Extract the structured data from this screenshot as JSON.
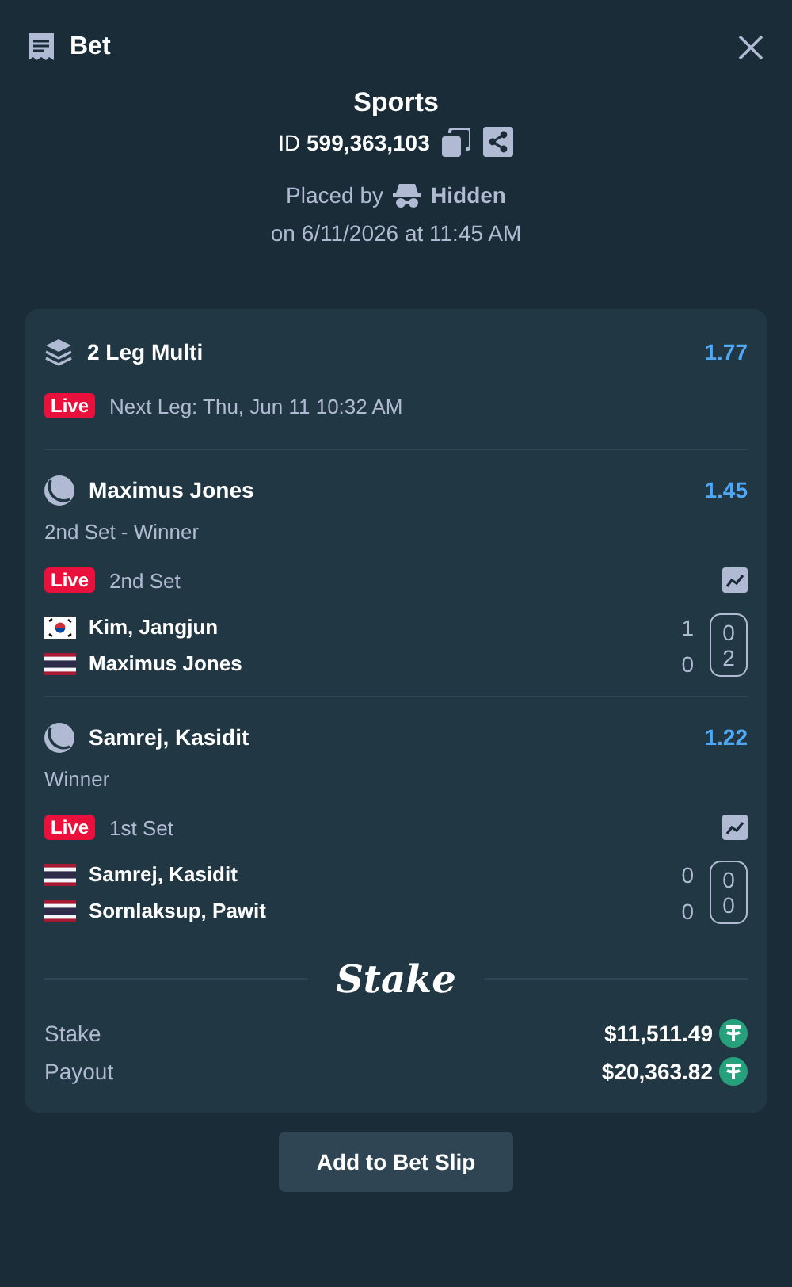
{
  "header": {
    "title": "Bet"
  },
  "summary": {
    "category": "Sports",
    "bet_id": "ID **599,363,103**",
    "placed_by_label": "Placed by",
    "user": "Hidden",
    "placed_on": "on 6/11/2026 at 11:45 AM"
  },
  "multi": {
    "title": "2 Leg Multi",
    "odds": "1.77",
    "live_badge": "Live",
    "next_leg": "Next Leg: Thu, Jun 11 10:32 AM"
  },
  "legs": [
    {
      "selection": "Maximus Jones",
      "odds": "1.45",
      "market": "2nd Set - Winner",
      "live_badge": "Live",
      "period": "2nd Set",
      "players": [
        {
          "name": "Kim, Jangjun",
          "kind": "kr",
          "score": "1",
          "current_score": "0"
        },
        {
          "name": "Maximus Jones",
          "kind": "th",
          "score": "0",
          "current_score": "2"
        }
      ]
    },
    {
      "selection": "Samrej, Kasidit",
      "odds": "1.22",
      "market": "Winner",
      "live_badge": "Live",
      "period": "1st Set",
      "players": [
        {
          "name": "Samrej, Kasidit",
          "kind": "th",
          "score": "0",
          "current_score": "0"
        },
        {
          "name": "Sornlaksup, Pawit",
          "kind": "th",
          "score": "0",
          "current_score": "0"
        }
      ]
    }
  ],
  "brand": "Stake",
  "totals": [
    {
      "label": "Stake",
      "amount": "$11,511.49"
    },
    {
      "label": "Payout",
      "amount": "$20,363.82"
    }
  ],
  "button": "Add to Bet Slip"
}
